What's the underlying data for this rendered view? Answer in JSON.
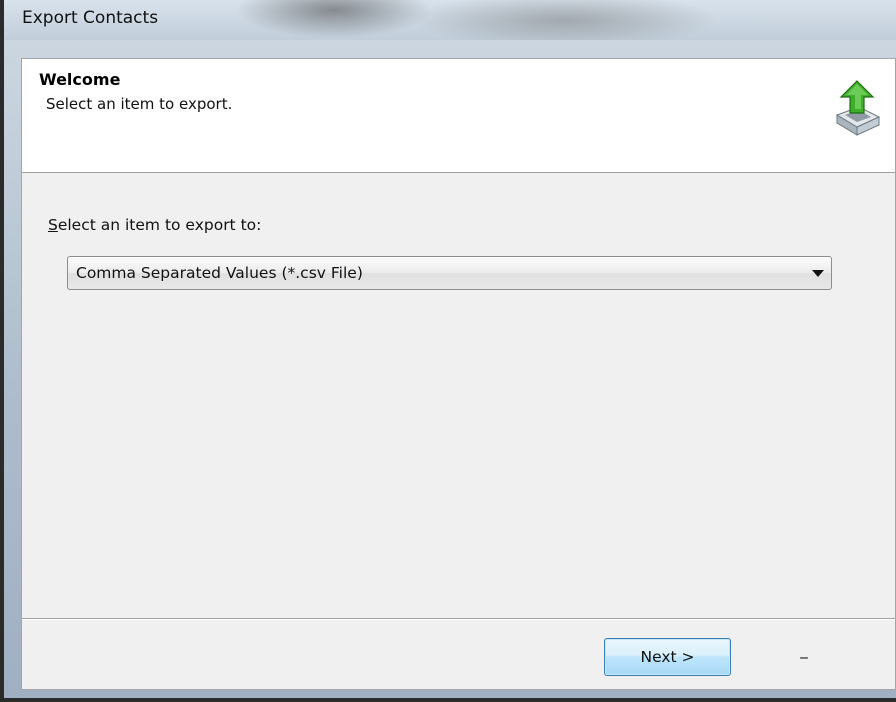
{
  "window": {
    "title": "Export Contacts"
  },
  "header": {
    "title": "Welcome",
    "subtitle": "Select an item to export.",
    "icon": "export-arrow-icon",
    "colors": {
      "arrow": "#3fae2a",
      "tray": "#cfd6dc"
    }
  },
  "main": {
    "prompt_label_accel": "S",
    "prompt_label_rest": "elect an item to export to:",
    "format_select": {
      "selected_value": "Comma Separated Values (*.csv File)"
    }
  },
  "footer": {
    "next_label": "Next >",
    "extra_label": "_"
  }
}
